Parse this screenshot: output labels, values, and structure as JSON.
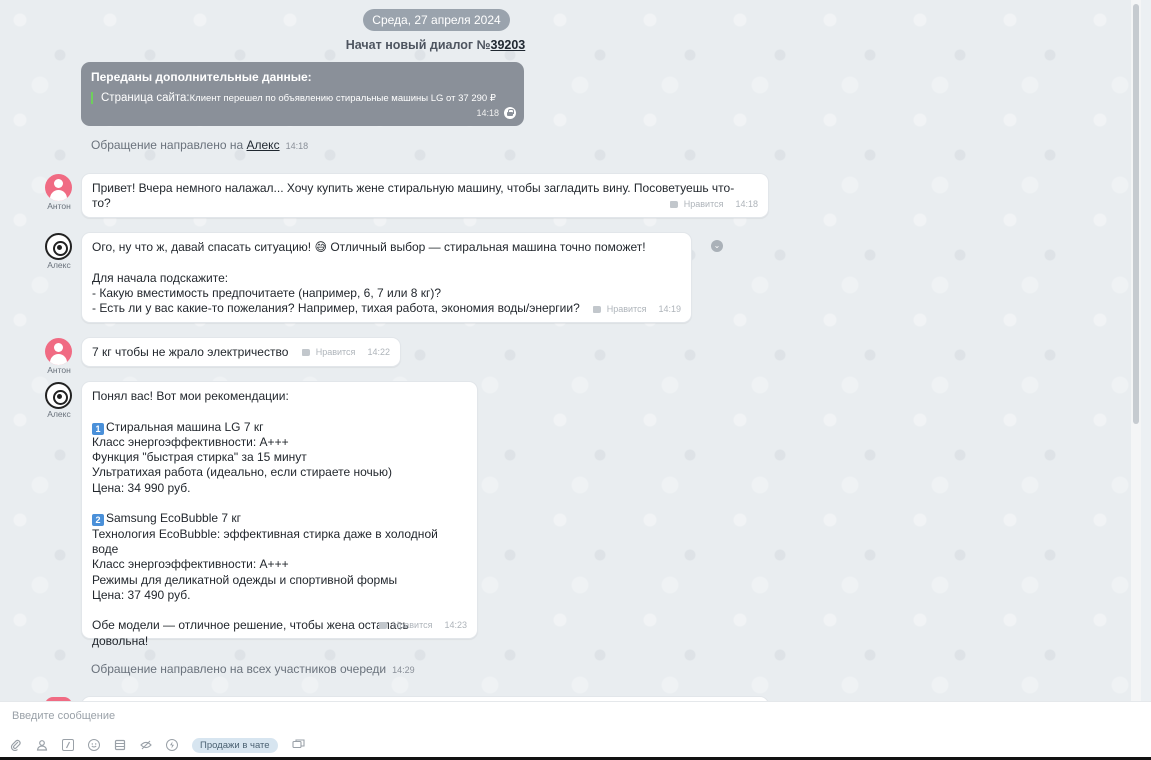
{
  "date_pill": "Среда, 27 апреля 2024",
  "new_dialog": {
    "prefix": "Начат новый диалог №",
    "number": "39203"
  },
  "system_card": {
    "title": "Переданы дополнительные данные:",
    "label": "Страница сайта:",
    "value": "Клиент перешел по объявлению стиральные машины LG от 37 290 ₽",
    "time": "14:18"
  },
  "routing_1": {
    "text": "Обращение направлено на ",
    "agent": "Алекс",
    "time": "14:18"
  },
  "routing_2": {
    "text": "Обращение направлено на всех участников очереди",
    "time": "14:29"
  },
  "like_label": "Нравится",
  "messages": [
    {
      "author": "Антон",
      "text": "Привет! Вчера немного налажал... Хочу купить жене стиральную машину, чтобы загладить вину. Посоветуешь что-\nто?",
      "time": "14:18"
    },
    {
      "author": "Алекс",
      "text": "Ого, ну что ж, давай спасать ситуацию! 😅 Отличный выбор — стиральная машина точно поможет!\n\nДля начала подскажите:\n- Какую вместимость предпочитаете (например, 6, 7 или 8 кг)?\n- Есть ли у вас какие-то пожелания? Например, тихая работа, экономия воды/энергии?",
      "time": "14:19"
    },
    {
      "author": "Антон",
      "text": "7 кг чтобы не жрало электричество",
      "time": "14:22"
    },
    {
      "author": "Алекс",
      "intro": "Понял вас! Вот мои рекомендации:",
      "option1": {
        "badge": "1",
        "title": "Стиральная машина LG 7 кг",
        "details": "Класс энергоэффективности: A+++\nФункция \"быстрая стирка\" за 15 минут\nУльтратихая работа (идеально, если стираете ночью)\nЦена: 34 990 руб."
      },
      "option2": {
        "badge": "2",
        "title": "Samsung EcoBubble 7 кг",
        "details": "Технология EcoBubble: эффективная стирка даже в холодной воде\nКласс энергоэффективности: A+++\nРежимы для деликатной одежды и спортивной формы\nЦена: 37 490 руб."
      },
      "outro": "Обе модели — отличное решение, чтобы жена осталась довольна!",
      "time": "14:23"
    }
  ],
  "composer": {
    "placeholder": "Введите сообщение",
    "sales_chip": "Продажи в чате"
  }
}
